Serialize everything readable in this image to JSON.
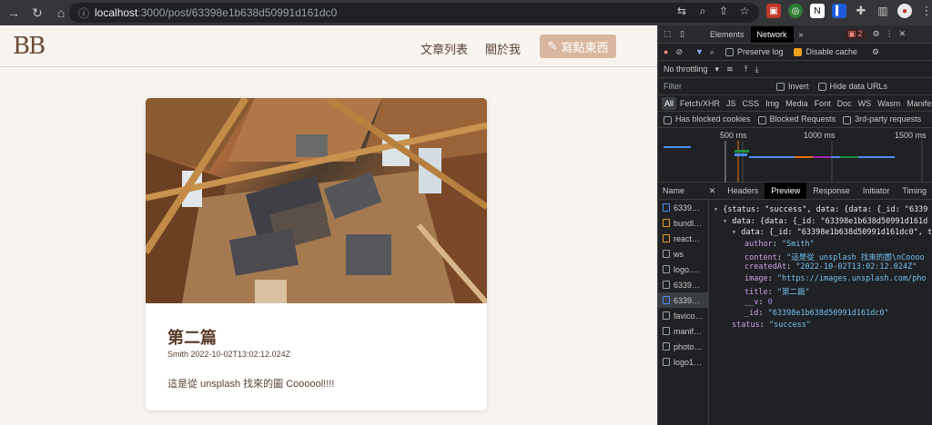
{
  "browser": {
    "url_host": "localhost",
    "url_path": ":3000/post/63398e1b638d50991d161dc0"
  },
  "site": {
    "logo": "BB",
    "nav": [
      "文章列表",
      "關於我"
    ],
    "write_label": "寫點東西"
  },
  "post": {
    "title": "第二篇",
    "meta": "Smith 2022-10-02T13:02:12.024Z",
    "content": "這是從 unsplash 找來的圖 Coooool!!!!"
  },
  "devtools": {
    "tabs": [
      "Elements",
      "Network"
    ],
    "active_tab": "Network",
    "issues_count": "2",
    "preserve_log": "Preserve log",
    "disable_cache": "Disable cache",
    "throttling": "No throttling",
    "filter_placeholder": "Filter",
    "invert": "Invert",
    "hide_data_urls": "Hide data URLs",
    "type_filters": [
      "All",
      "Fetch/XHR",
      "JS",
      "CSS",
      "Img",
      "Media",
      "Font",
      "Doc",
      "WS",
      "Wasm",
      "Manifest"
    ],
    "blocked_cookies": "Has blocked cookies",
    "blocked_requests": "Blocked Requests",
    "third_party": "3rd-party requests",
    "timeline_ticks": [
      "500 ms",
      "1000 ms",
      "1500 ms"
    ],
    "name_header": "Name",
    "detail_tabs": [
      "Headers",
      "Preview",
      "Response",
      "Initiator",
      "Timing"
    ],
    "requests": [
      "6339…",
      "bundl…",
      "react…",
      "ws",
      "logo.…",
      "6339…",
      "6339…",
      "favico…",
      "manif…",
      "photo…",
      "logo1…"
    ],
    "preview_lines": [
      "{status: \"success\", data: {data: {_id: \"6339",
      "data: {data: {_id: \"63398e1b638d50991d161d",
      "data: {_id: \"63398e1b638d50991d161dc0\", t",
      "author: \"Smith\"",
      "content: \"這是從 unsplash 找來的圖\\nCoooo",
      "createdAt: \"2022-10-02T13:02:12.024Z\"",
      "image: \"https://images.unsplash.com/pho",
      "title: \"第二篇\"",
      "__v: 0",
      "_id: \"63398e1b638d50991d161dc0\"",
      "status: \"success\""
    ]
  }
}
